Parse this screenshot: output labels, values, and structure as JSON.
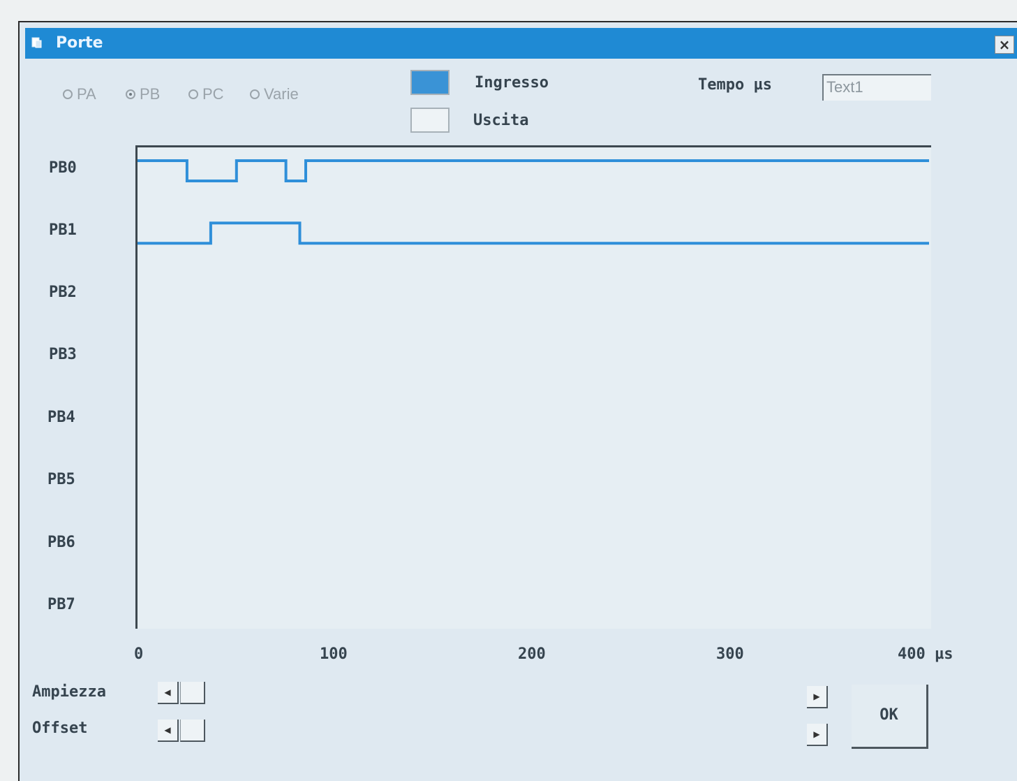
{
  "window": {
    "title": "Porte",
    "close": "×"
  },
  "ports": [
    {
      "label": "PA",
      "selected": false
    },
    {
      "label": "PB",
      "selected": true
    },
    {
      "label": "PC",
      "selected": false
    },
    {
      "label": "Varie",
      "selected": false
    }
  ],
  "legend": {
    "input_label": "Ingresso",
    "input_color": "#3a93d6",
    "output_label": "Uscita",
    "output_color": "#eef3f6"
  },
  "time": {
    "label": "Tempo µs",
    "value": "Text1"
  },
  "signals": [
    "PB0",
    "PB1",
    "PB2",
    "PB3",
    "PB4",
    "PB5",
    "PB6",
    "PB7"
  ],
  "axis": {
    "ticks": [
      "0",
      "100",
      "200",
      "300"
    ],
    "last_tick": "400 µs"
  },
  "controls": {
    "amplitude_label": "Ampiezza",
    "offset_label": "Offset",
    "ok_label": "OK"
  },
  "chart_data": {
    "type": "line",
    "xlabel": "µs",
    "xlim": [
      0,
      400
    ],
    "series_color": "#2f8fd9",
    "series": [
      {
        "name": "PB0",
        "x": [
          0,
          25,
          25,
          50,
          50,
          75,
          75,
          85,
          85,
          400
        ],
        "y": [
          1,
          1,
          0,
          0,
          1,
          1,
          0,
          0,
          1,
          1
        ]
      },
      {
        "name": "PB1",
        "x": [
          0,
          37,
          37,
          82,
          82,
          400
        ],
        "y": [
          0,
          0,
          1,
          1,
          0,
          0
        ]
      }
    ]
  }
}
